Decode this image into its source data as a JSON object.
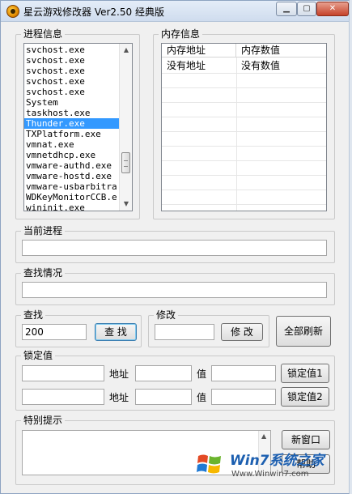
{
  "window": {
    "title": "星云游戏修改器 Ver2.50 经典版",
    "min_label": "▁",
    "max_label": "▢",
    "close_label": "✕"
  },
  "process_info": {
    "label": "进程信息",
    "items": [
      "svchost.exe",
      "svchost.exe",
      "svchost.exe",
      "svchost.exe",
      "svchost.exe",
      "System",
      "taskhost.exe",
      "Thunder.exe",
      "TXPlatform.exe",
      "vmnat.exe",
      "vmnetdhcp.exe",
      "vmware-authd.exe",
      "vmware-hostd.exe",
      "vmware-usbarbitra",
      "WDKeyMonitorCCB.e",
      "wininit.exe"
    ],
    "selected_index": 7,
    "scroll_up": "▲",
    "scroll_down": "▼"
  },
  "memory_info": {
    "label": "内存信息",
    "columns": [
      "内存地址",
      "内存数值"
    ],
    "rows": [
      [
        "没有地址",
        "没有数值"
      ]
    ]
  },
  "current_process": {
    "label": "当前进程",
    "value": ""
  },
  "search_status": {
    "label": "查找情况",
    "value": ""
  },
  "search": {
    "label": "查找",
    "value": "200",
    "button": "查 找"
  },
  "modify": {
    "label": "修改",
    "value": "",
    "button": "修 改"
  },
  "refresh_all": {
    "button": "全部刷新"
  },
  "locked": {
    "label": "锁定值",
    "address_label": "地址",
    "value_label": "值",
    "rows": [
      {
        "name_value": "",
        "address_value": "",
        "value_value": "",
        "button": "锁定值1"
      },
      {
        "name_value": "",
        "address_value": "",
        "value_value": "",
        "button": "锁定值2"
      }
    ]
  },
  "special_tips": {
    "label": "特别提示",
    "value": "",
    "new_window_button": "新窗口",
    "help_button": "帮助"
  },
  "watermark": {
    "brand": "Win7系统之家",
    "url": "Www.Winwin7.com"
  },
  "colors": {
    "selection": "#3399ff",
    "titlebar": "#d8e4f2",
    "close": "#c5422a",
    "watermark_blue": "#1c5fb0"
  }
}
